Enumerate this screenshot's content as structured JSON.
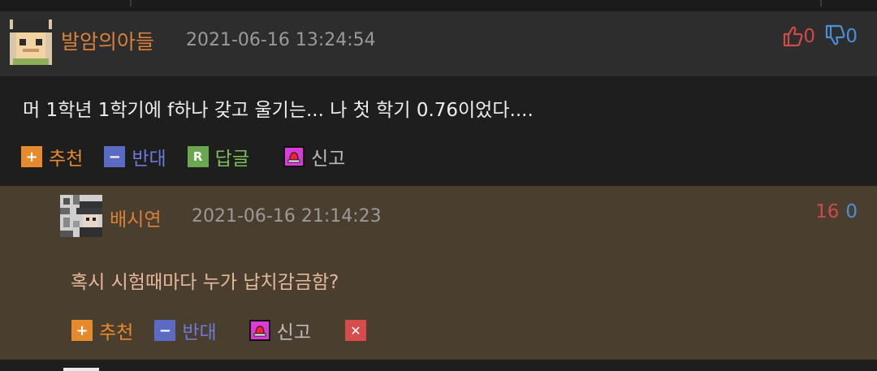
{
  "comment": {
    "author": "발암의아들",
    "timestamp": "2021-06-16 13:24:54",
    "upvotes": "0",
    "downvotes": "0",
    "text": "머 1학년 1학기에 f하나 갖고 울기는... 나 첫 학기 0.76이었다....",
    "actions": {
      "recommend": "추천",
      "oppose": "반대",
      "reply": "답글",
      "report": "신고"
    },
    "icons": {
      "reply_badge": "R",
      "upvote": "thumbs-up-icon",
      "downvote": "thumbs-down-icon"
    }
  },
  "reply": {
    "author": "배시연",
    "timestamp": "2021-06-16 21:14:23",
    "upvotes": "16",
    "downvotes": "0",
    "text": "혹시 시험때마다 누가 납치감금함?",
    "actions": {
      "recommend": "추천",
      "oppose": "반대",
      "report": "신고"
    },
    "icons": {
      "delete": "✕"
    }
  },
  "colors": {
    "author": "#d9813a",
    "upvote": "#d14a4a",
    "downvote": "#4a90d9",
    "reply_background": "#4a3e2f",
    "header_background": "#2d2d2d"
  }
}
